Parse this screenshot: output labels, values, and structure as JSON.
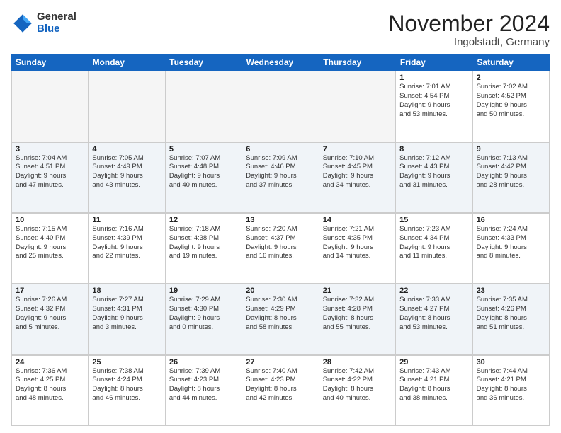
{
  "logo": {
    "general": "General",
    "blue": "Blue"
  },
  "title": "November 2024",
  "location": "Ingolstadt, Germany",
  "header_days": [
    "Sunday",
    "Monday",
    "Tuesday",
    "Wednesday",
    "Thursday",
    "Friday",
    "Saturday"
  ],
  "rows": [
    {
      "alt": false,
      "cells": [
        {
          "empty": true,
          "day": "",
          "info": ""
        },
        {
          "empty": true,
          "day": "",
          "info": ""
        },
        {
          "empty": true,
          "day": "",
          "info": ""
        },
        {
          "empty": true,
          "day": "",
          "info": ""
        },
        {
          "empty": true,
          "day": "",
          "info": ""
        },
        {
          "empty": false,
          "day": "1",
          "info": "Sunrise: 7:01 AM\nSunset: 4:54 PM\nDaylight: 9 hours\nand 53 minutes."
        },
        {
          "empty": false,
          "day": "2",
          "info": "Sunrise: 7:02 AM\nSunset: 4:52 PM\nDaylight: 9 hours\nand 50 minutes."
        }
      ]
    },
    {
      "alt": true,
      "cells": [
        {
          "empty": false,
          "day": "3",
          "info": "Sunrise: 7:04 AM\nSunset: 4:51 PM\nDaylight: 9 hours\nand 47 minutes."
        },
        {
          "empty": false,
          "day": "4",
          "info": "Sunrise: 7:05 AM\nSunset: 4:49 PM\nDaylight: 9 hours\nand 43 minutes."
        },
        {
          "empty": false,
          "day": "5",
          "info": "Sunrise: 7:07 AM\nSunset: 4:48 PM\nDaylight: 9 hours\nand 40 minutes."
        },
        {
          "empty": false,
          "day": "6",
          "info": "Sunrise: 7:09 AM\nSunset: 4:46 PM\nDaylight: 9 hours\nand 37 minutes."
        },
        {
          "empty": false,
          "day": "7",
          "info": "Sunrise: 7:10 AM\nSunset: 4:45 PM\nDaylight: 9 hours\nand 34 minutes."
        },
        {
          "empty": false,
          "day": "8",
          "info": "Sunrise: 7:12 AM\nSunset: 4:43 PM\nDaylight: 9 hours\nand 31 minutes."
        },
        {
          "empty": false,
          "day": "9",
          "info": "Sunrise: 7:13 AM\nSunset: 4:42 PM\nDaylight: 9 hours\nand 28 minutes."
        }
      ]
    },
    {
      "alt": false,
      "cells": [
        {
          "empty": false,
          "day": "10",
          "info": "Sunrise: 7:15 AM\nSunset: 4:40 PM\nDaylight: 9 hours\nand 25 minutes."
        },
        {
          "empty": false,
          "day": "11",
          "info": "Sunrise: 7:16 AM\nSunset: 4:39 PM\nDaylight: 9 hours\nand 22 minutes."
        },
        {
          "empty": false,
          "day": "12",
          "info": "Sunrise: 7:18 AM\nSunset: 4:38 PM\nDaylight: 9 hours\nand 19 minutes."
        },
        {
          "empty": false,
          "day": "13",
          "info": "Sunrise: 7:20 AM\nSunset: 4:37 PM\nDaylight: 9 hours\nand 16 minutes."
        },
        {
          "empty": false,
          "day": "14",
          "info": "Sunrise: 7:21 AM\nSunset: 4:35 PM\nDaylight: 9 hours\nand 14 minutes."
        },
        {
          "empty": false,
          "day": "15",
          "info": "Sunrise: 7:23 AM\nSunset: 4:34 PM\nDaylight: 9 hours\nand 11 minutes."
        },
        {
          "empty": false,
          "day": "16",
          "info": "Sunrise: 7:24 AM\nSunset: 4:33 PM\nDaylight: 9 hours\nand 8 minutes."
        }
      ]
    },
    {
      "alt": true,
      "cells": [
        {
          "empty": false,
          "day": "17",
          "info": "Sunrise: 7:26 AM\nSunset: 4:32 PM\nDaylight: 9 hours\nand 5 minutes."
        },
        {
          "empty": false,
          "day": "18",
          "info": "Sunrise: 7:27 AM\nSunset: 4:31 PM\nDaylight: 9 hours\nand 3 minutes."
        },
        {
          "empty": false,
          "day": "19",
          "info": "Sunrise: 7:29 AM\nSunset: 4:30 PM\nDaylight: 9 hours\nand 0 minutes."
        },
        {
          "empty": false,
          "day": "20",
          "info": "Sunrise: 7:30 AM\nSunset: 4:29 PM\nDaylight: 8 hours\nand 58 minutes."
        },
        {
          "empty": false,
          "day": "21",
          "info": "Sunrise: 7:32 AM\nSunset: 4:28 PM\nDaylight: 8 hours\nand 55 minutes."
        },
        {
          "empty": false,
          "day": "22",
          "info": "Sunrise: 7:33 AM\nSunset: 4:27 PM\nDaylight: 8 hours\nand 53 minutes."
        },
        {
          "empty": false,
          "day": "23",
          "info": "Sunrise: 7:35 AM\nSunset: 4:26 PM\nDaylight: 8 hours\nand 51 minutes."
        }
      ]
    },
    {
      "alt": false,
      "cells": [
        {
          "empty": false,
          "day": "24",
          "info": "Sunrise: 7:36 AM\nSunset: 4:25 PM\nDaylight: 8 hours\nand 48 minutes."
        },
        {
          "empty": false,
          "day": "25",
          "info": "Sunrise: 7:38 AM\nSunset: 4:24 PM\nDaylight: 8 hours\nand 46 minutes."
        },
        {
          "empty": false,
          "day": "26",
          "info": "Sunrise: 7:39 AM\nSunset: 4:23 PM\nDaylight: 8 hours\nand 44 minutes."
        },
        {
          "empty": false,
          "day": "27",
          "info": "Sunrise: 7:40 AM\nSunset: 4:23 PM\nDaylight: 8 hours\nand 42 minutes."
        },
        {
          "empty": false,
          "day": "28",
          "info": "Sunrise: 7:42 AM\nSunset: 4:22 PM\nDaylight: 8 hours\nand 40 minutes."
        },
        {
          "empty": false,
          "day": "29",
          "info": "Sunrise: 7:43 AM\nSunset: 4:21 PM\nDaylight: 8 hours\nand 38 minutes."
        },
        {
          "empty": false,
          "day": "30",
          "info": "Sunrise: 7:44 AM\nSunset: 4:21 PM\nDaylight: 8 hours\nand 36 minutes."
        }
      ]
    }
  ]
}
